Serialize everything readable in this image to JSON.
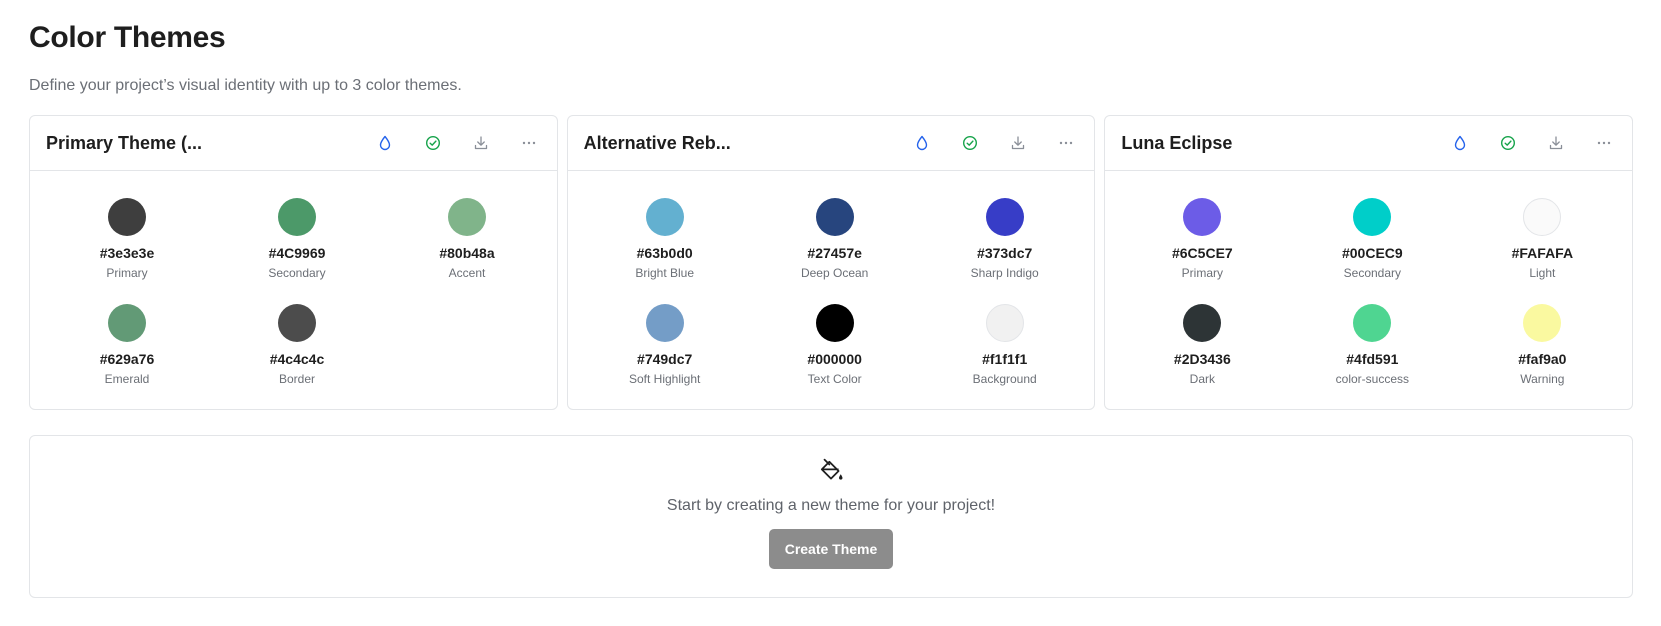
{
  "header": {
    "title": "Color Themes",
    "subtitle": "Define your project’s visual identity with up to 3 color themes."
  },
  "colors": {
    "icon_blue": "#2563eb",
    "icon_green": "#16a34a",
    "icon_gray": "#8a8f98",
    "button_bg": "#8c8c8c"
  },
  "themes": [
    {
      "title": "Primary Theme (...",
      "swatches": [
        {
          "hex": "#3e3e3e",
          "label": "Primary",
          "color": "#3e3e3e"
        },
        {
          "hex": "#4C9969",
          "label": "Secondary",
          "color": "#4C9969"
        },
        {
          "hex": "#80b48a",
          "label": "Accent",
          "color": "#80b48a"
        },
        {
          "hex": "#629a76",
          "label": "Emerald",
          "color": "#629a76"
        },
        {
          "hex": "#4c4c4c",
          "label": "Border",
          "color": "#4c4c4c"
        }
      ]
    },
    {
      "title": "Alternative Reb...",
      "swatches": [
        {
          "hex": "#63b0d0",
          "label": "Bright Blue",
          "color": "#63b0d0"
        },
        {
          "hex": "#27457e",
          "label": "Deep Ocean",
          "color": "#27457e"
        },
        {
          "hex": "#373dc7",
          "label": "Sharp Indigo",
          "color": "#373dc7"
        },
        {
          "hex": "#749dc7",
          "label": "Soft Highlight",
          "color": "#749dc7"
        },
        {
          "hex": "#000000",
          "label": "Text Color",
          "color": "#000000"
        },
        {
          "hex": "#f1f1f1",
          "label": "Background",
          "color": "#f1f1f1"
        }
      ]
    },
    {
      "title": "Luna Eclipse",
      "swatches": [
        {
          "hex": "#6C5CE7",
          "label": "Primary",
          "color": "#6C5CE7"
        },
        {
          "hex": "#00CEC9",
          "label": "Secondary",
          "color": "#00CEC9"
        },
        {
          "hex": "#FAFAFA",
          "label": "Light",
          "color": "#FAFAFA"
        },
        {
          "hex": "#2D3436",
          "label": "Dark",
          "color": "#2D3436"
        },
        {
          "hex": "#4fd591",
          "label": "color-success",
          "color": "#4fd591"
        },
        {
          "hex": "#faf9a0",
          "label": "Warning",
          "color": "#faf9a0"
        }
      ]
    }
  ],
  "empty_state": {
    "icon": "paint-bucket-icon",
    "message": "Start by creating a new theme for your project!",
    "button_label": "Create Theme"
  }
}
